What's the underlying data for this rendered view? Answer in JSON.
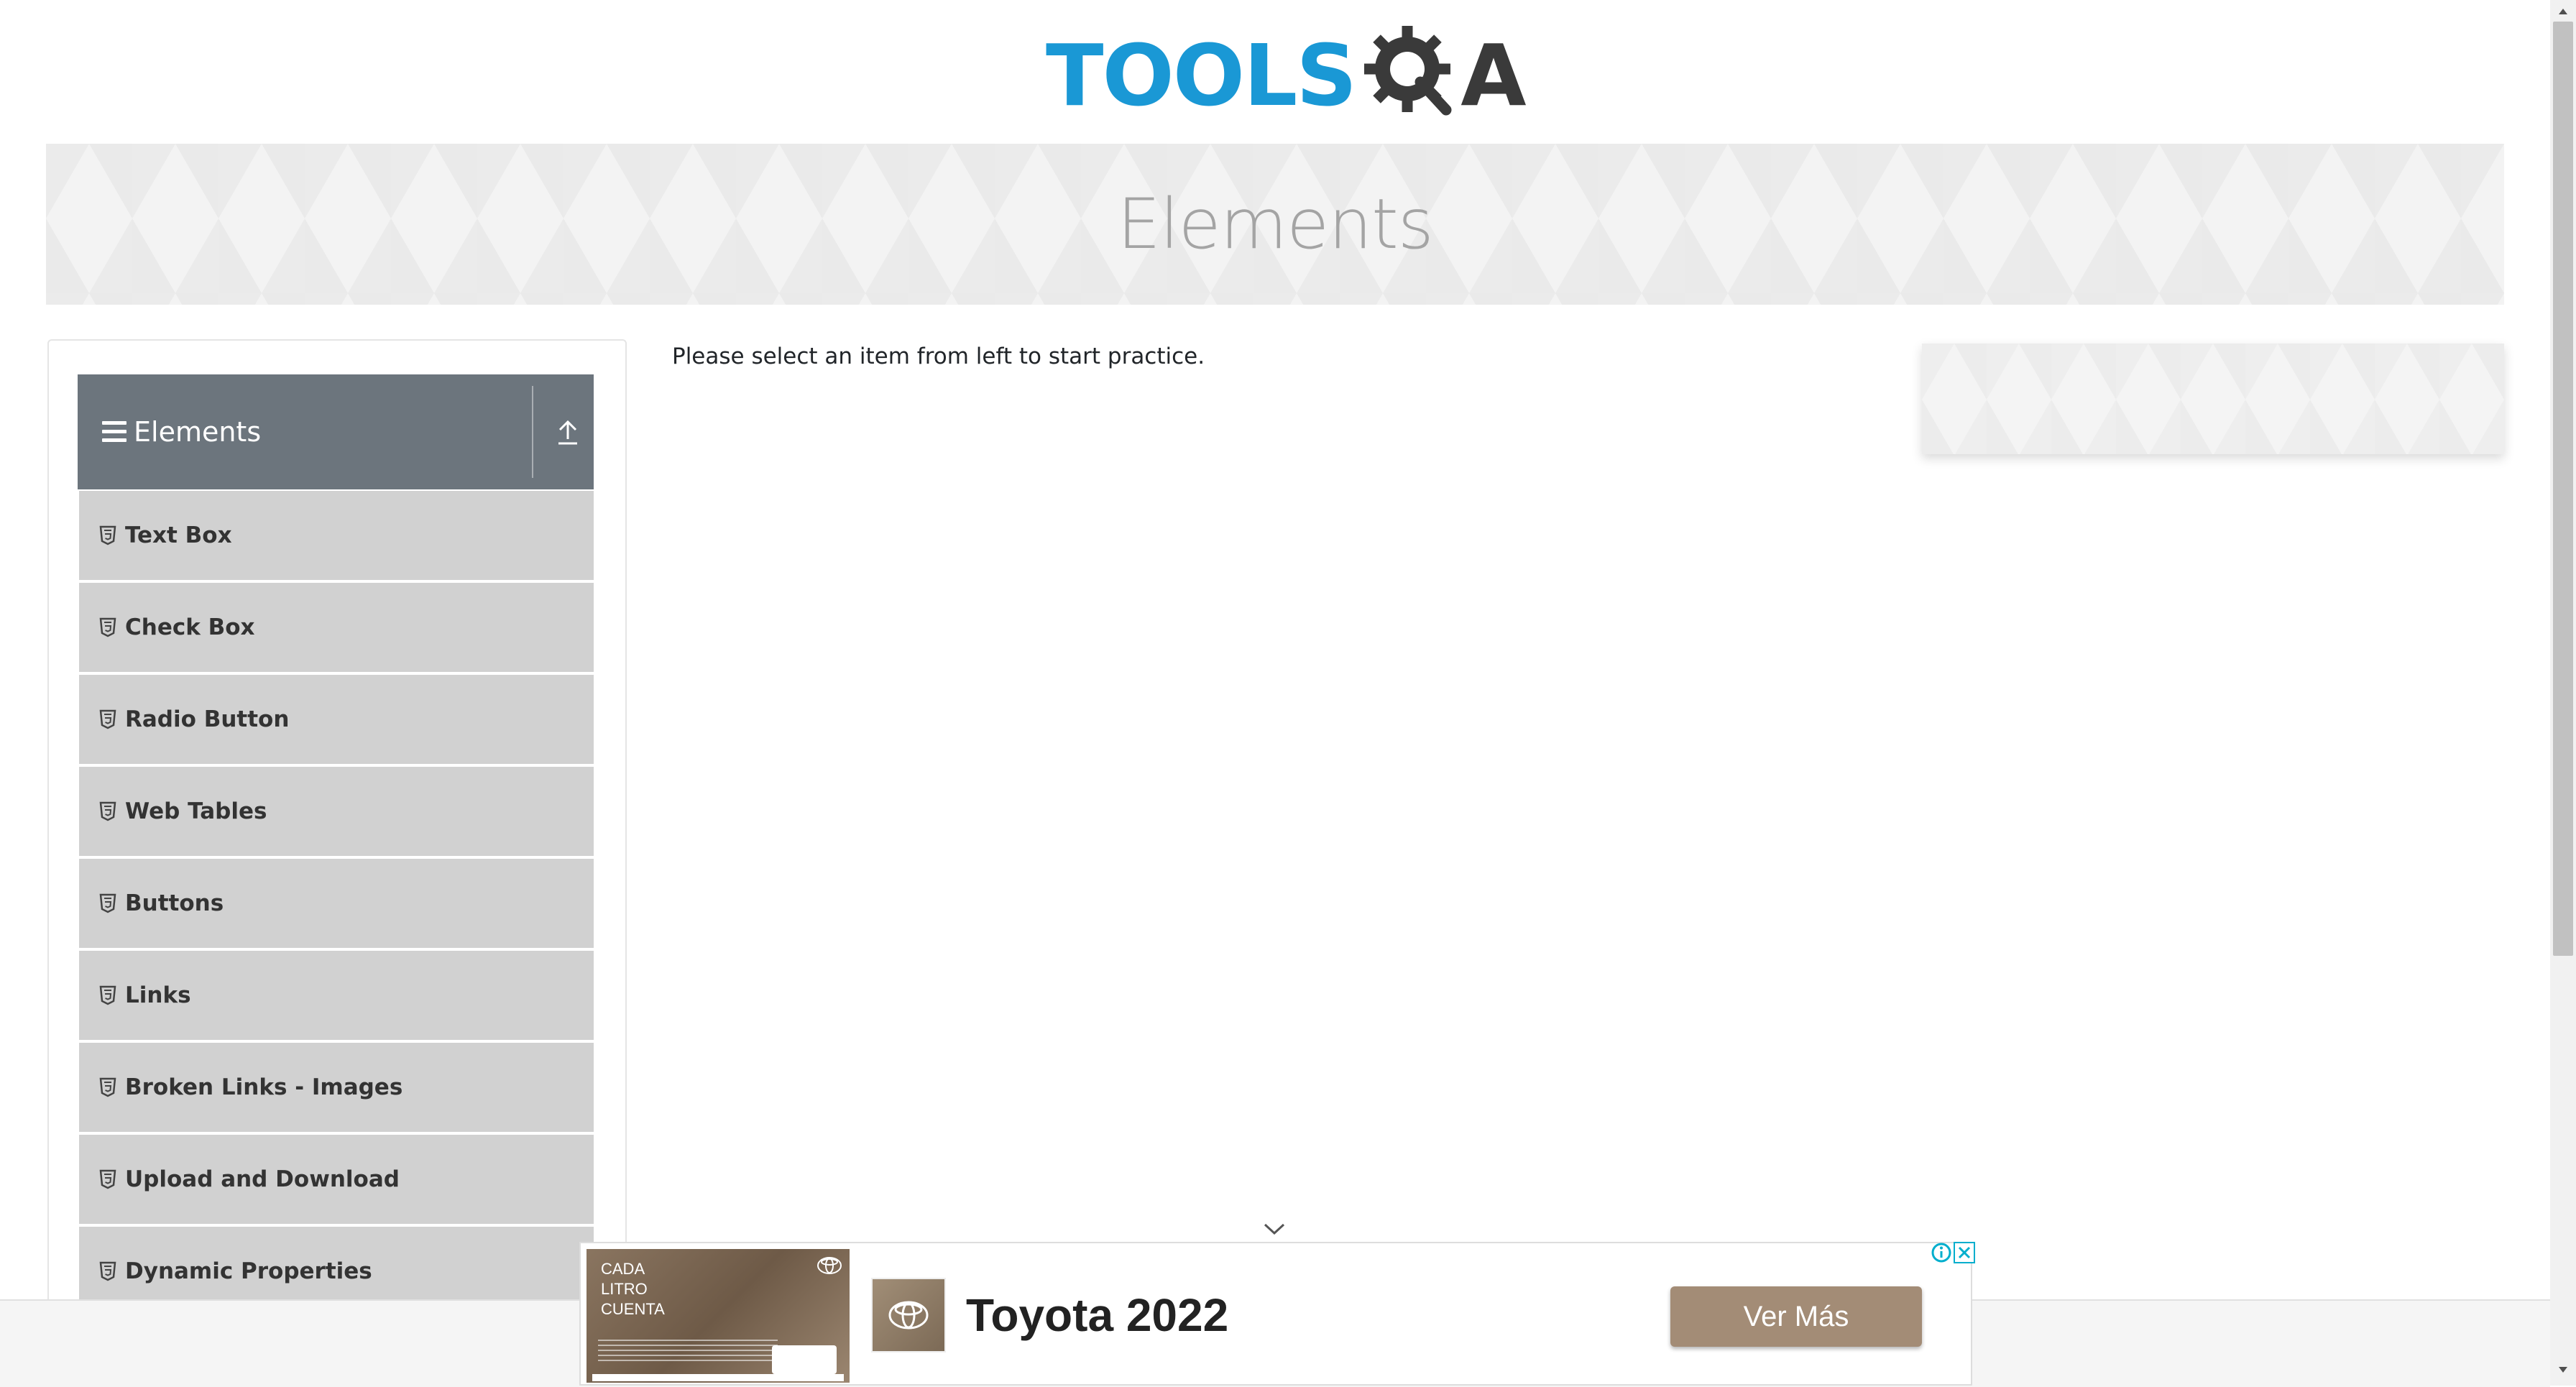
{
  "header": {
    "logo_text": "TOOLS",
    "logo_suffix": "A",
    "logo_alt": "TOOLSQA"
  },
  "banner": {
    "title": "Elements"
  },
  "sidebar": {
    "group_title": "Elements",
    "items": [
      {
        "label": "Text Box"
      },
      {
        "label": "Check Box"
      },
      {
        "label": "Radio Button"
      },
      {
        "label": "Web Tables"
      },
      {
        "label": "Buttons"
      },
      {
        "label": "Links"
      },
      {
        "label": "Broken Links - Images"
      },
      {
        "label": "Upload and Download"
      },
      {
        "label": "Dynamic Properties"
      }
    ]
  },
  "main": {
    "instruction": "Please select an item from left to start practice."
  },
  "ad": {
    "thumb_text_line1": "CADA",
    "thumb_text_line2": "LITRO",
    "thumb_text_line3": "CUENTA",
    "title": "Toyota 2022",
    "cta": "Ver Más"
  },
  "colors": {
    "brand_blue": "#1a98d5",
    "group_header_bg": "#6c757d",
    "menu_item_bg": "#d1d1d1",
    "ad_cta_bg": "#a38c76"
  },
  "icons": {
    "menu": "hamburger-icon",
    "toggle": "arrow-up-icon",
    "item": "html5-icon",
    "ad_info": "info-icon",
    "ad_close": "close-icon"
  }
}
